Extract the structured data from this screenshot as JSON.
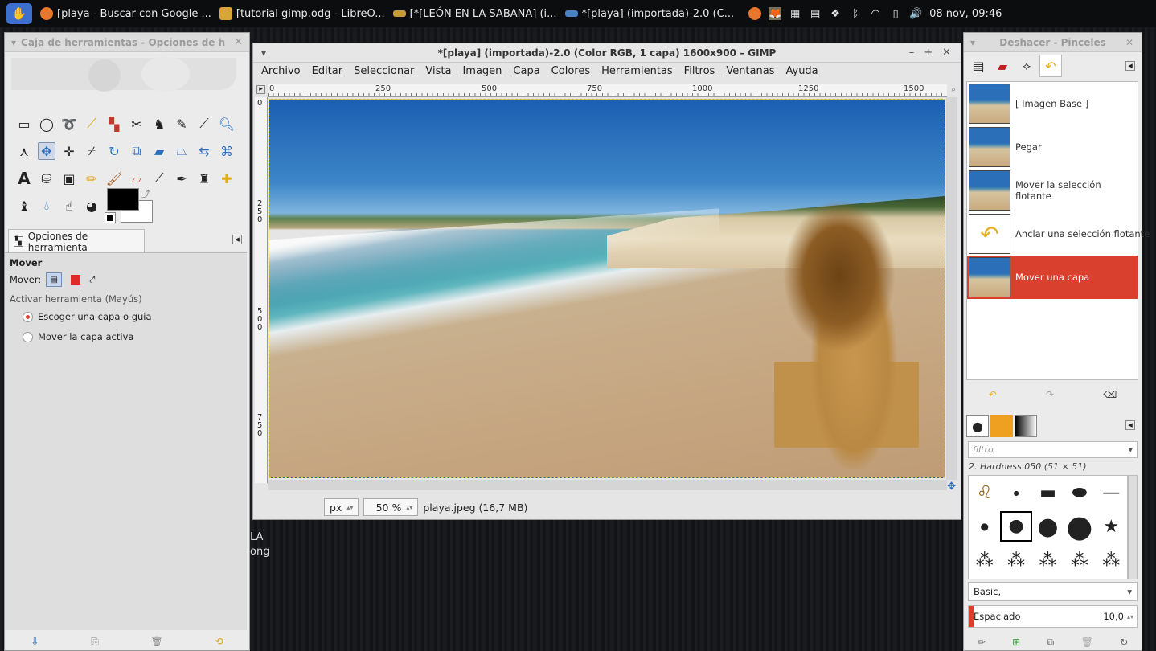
{
  "taskbar": {
    "tasks": [
      {
        "label": "[playa - Buscar con Google ...",
        "icon": "firefox-icon",
        "color": "#e8772e"
      },
      {
        "label": "[tutorial gimp.odg - LibreO...",
        "icon": "libreoffice-draw-icon",
        "color": "#d8a53a"
      },
      {
        "label": "[*[LEÓN EN LA SABANA] (i...",
        "icon": "gimp-image-icon",
        "color": "#c79a3c"
      },
      {
        "label": "*[playa] (importada)-2.0 (C...",
        "icon": "gimp-image-icon",
        "color": "#4a83c2"
      }
    ],
    "clock": "08 nov, 09:46"
  },
  "toolbox": {
    "title": "Caja de herramientas - Opciones de h",
    "options_tab": "Opciones de herramienta",
    "tool_name": "Mover",
    "mover_label": "Mover:",
    "activate_label": "Activar herramienta  (Mayús)",
    "radio_options": [
      "Escoger una capa o guía",
      "Mover la capa activa"
    ]
  },
  "image_window": {
    "title": "*[playa] (importada)-2.0 (Color RGB, 1 capa) 1600x900 – GIMP",
    "menu": [
      "Archivo",
      "Editar",
      "Seleccionar",
      "Vista",
      "Imagen",
      "Capa",
      "Colores",
      "Herramientas",
      "Filtros",
      "Ventanas",
      "Ayuda"
    ],
    "ruler_marks": [
      "0",
      "250",
      "500",
      "750",
      "1000",
      "1250",
      "1500"
    ],
    "vruler_marks": [
      "2 5 0",
      "5 0 0",
      "7 5 0"
    ],
    "unit": "px",
    "zoom": "50 %",
    "status": "playa.jpeg (16,7 MB)"
  },
  "dock": {
    "title": "Deshacer - Pinceles",
    "history": [
      "[ Imagen Base ]",
      "Pegar",
      "Mover la selección flotante",
      "Anclar una selección flotante",
      "Mover una capa"
    ],
    "filter_placeholder": "filtro",
    "brush_name": "2. Hardness 050 (51 × 51)",
    "preset": "Basic,",
    "spacing_label": "Espaciado",
    "spacing_value": "10,0"
  },
  "background_text": [
    "LA",
    "ong"
  ]
}
